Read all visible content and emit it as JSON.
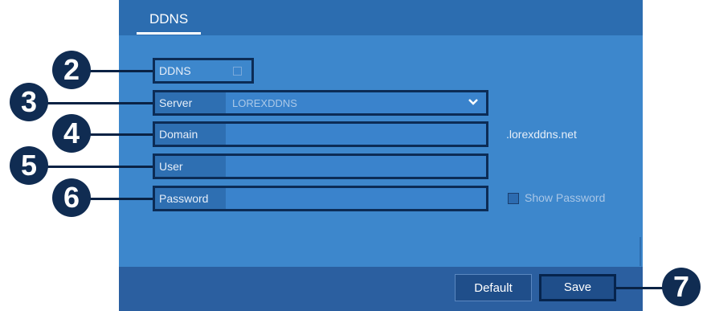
{
  "header": {
    "tab": "DDNS"
  },
  "form": {
    "ddns_label": "DDNS",
    "server_label": "Server",
    "server_value": "LOREXDDNS",
    "domain_label": "Domain",
    "domain_suffix": ".lorexddns.net",
    "user_label": "User",
    "password_label": "Password",
    "show_password_label": "Show Password"
  },
  "footer": {
    "default_label": "Default",
    "save_label": "Save"
  },
  "callouts": [
    "2",
    "3",
    "4",
    "5",
    "6",
    "7"
  ],
  "colors": {
    "panel": "#3d87cc",
    "header": "#2c6db0",
    "callout": "#102c52"
  }
}
